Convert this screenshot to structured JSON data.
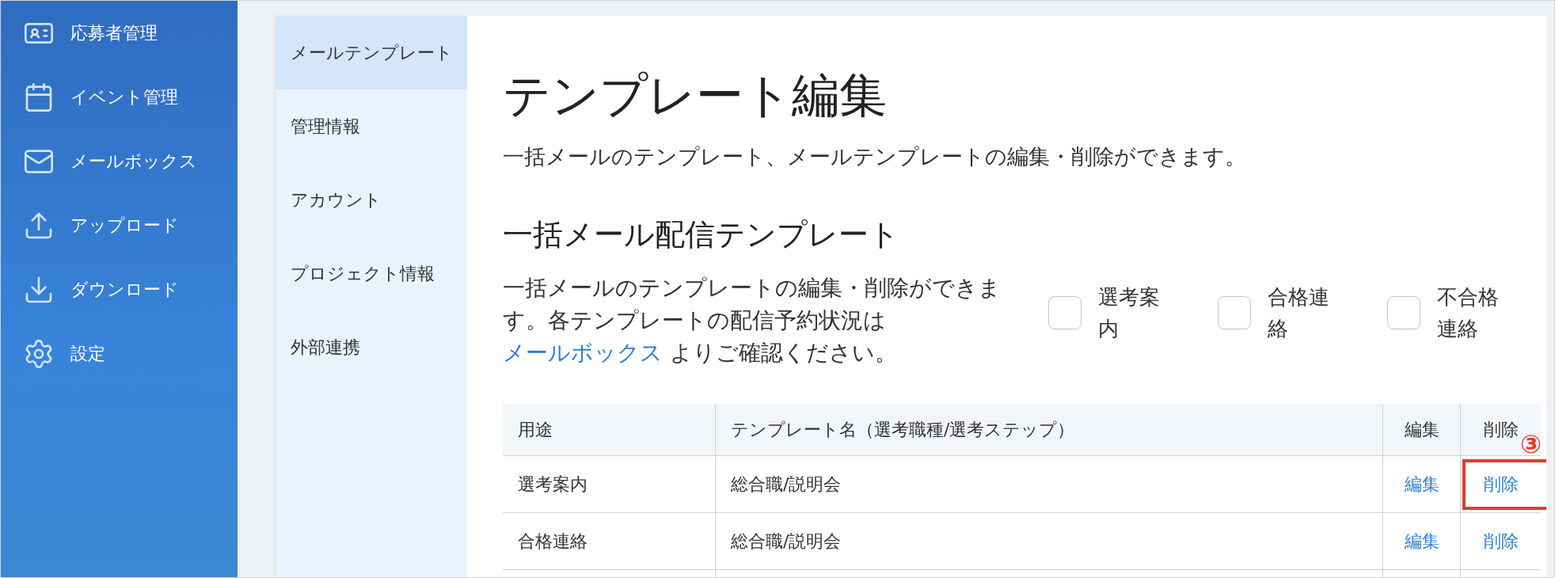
{
  "sidebar": {
    "items": [
      {
        "label": "応募者管理"
      },
      {
        "label": "イベント管理"
      },
      {
        "label": "メールボックス"
      },
      {
        "label": "アップロード"
      },
      {
        "label": "ダウンロード"
      },
      {
        "label": "設定"
      }
    ]
  },
  "settings_nav": {
    "items": [
      {
        "label": "メールテンプレート",
        "selected": true
      },
      {
        "label": "管理情報",
        "selected": false
      },
      {
        "label": "アカウント",
        "selected": false
      },
      {
        "label": "プロジェクト情報",
        "selected": false
      },
      {
        "label": "外部連携",
        "selected": false
      }
    ]
  },
  "page": {
    "title": "テンプレート編集",
    "subtitle": "一括メールのテンプレート、メールテンプレートの編集・削除ができます。"
  },
  "section": {
    "title": "一括メール配信テンプレート",
    "description": {
      "before": "一括メールのテンプレートの編集・削除ができます。各テンプレートの配信予約状況は ",
      "link": "メールボックス",
      "after": " よりご確認ください。"
    },
    "filters": [
      {
        "label": "選考案内",
        "checked": false
      },
      {
        "label": "合格連絡",
        "checked": false
      },
      {
        "label": "不合格連絡",
        "checked": false
      }
    ]
  },
  "table": {
    "columns": [
      "用途",
      "テンプレート名（選考職種/選考ステップ）",
      "編集",
      "削除"
    ],
    "rows": [
      {
        "purpose": "選考案内",
        "template_name": "総合職/説明会",
        "edit": {
          "label": "編集"
        },
        "delete": {
          "label": "削除",
          "highlighted": true,
          "callout": "③"
        }
      },
      {
        "purpose": "合格連絡",
        "template_name": "総合職/説明会",
        "edit": {
          "label": "編集"
        },
        "delete": {
          "label": "削除",
          "highlighted": false
        }
      }
    ]
  }
}
